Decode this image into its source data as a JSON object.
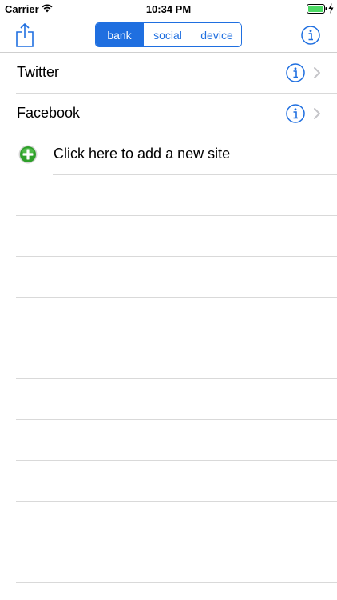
{
  "status_bar": {
    "carrier": "Carrier",
    "time": "10:34 PM",
    "wifi_icon": "wifi-icon",
    "battery_icon": "battery-full-icon",
    "charging_icon": "charging-bolt-icon",
    "battery_color": "#4cd964"
  },
  "nav": {
    "share_icon": "share-icon",
    "info_icon": "info-icon",
    "segments": [
      {
        "label": "bank",
        "selected": true
      },
      {
        "label": "social",
        "selected": false
      },
      {
        "label": "device",
        "selected": false
      }
    ],
    "accent_color": "#1f6fe0"
  },
  "list": {
    "items": [
      {
        "label": "Twitter",
        "info_icon": "info-icon",
        "chevron_icon": "chevron-right-icon"
      },
      {
        "label": "Facebook",
        "info_icon": "info-icon",
        "chevron_icon": "chevron-right-icon"
      }
    ],
    "add_row": {
      "label": "Click here to add a new site",
      "icon": "add-circle-icon",
      "icon_color": "#2fa02a"
    }
  }
}
